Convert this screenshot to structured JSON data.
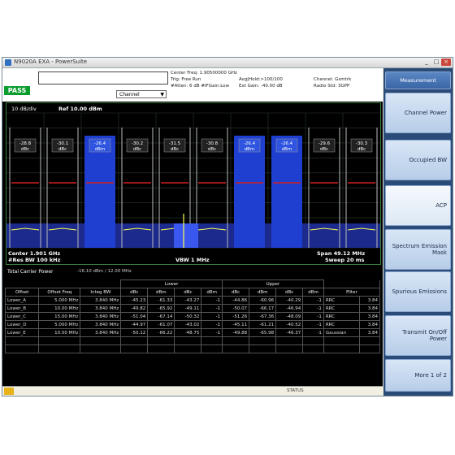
{
  "window": {
    "title": "N9020A EXA - PowerSuite",
    "minimize": "_",
    "maximize": "□",
    "close": "×"
  },
  "status": {
    "pass_label": "PASS",
    "mode_dropdown": "Channel",
    "settings": {
      "line1": "Center Freq: 1.90500000 GHz",
      "line2a": "Trig: Free Run",
      "line2b": "Avg|Hold:>100/100",
      "line2c": "Channel: Gsmtrk",
      "line3a": "#Atten: 6 dB #IFGain:Low",
      "line3b": "Ext Gain: -40.00 dB",
      "line3c": "Radio Std: 3GPP"
    }
  },
  "spectrum": {
    "y_label": "10 dB/div",
    "ref_label": "Ref 10.00 dBm",
    "center": "Center 1.901 GHz",
    "res_bw": "#Res BW 100 kHz",
    "vbw": "VBW 1 MHz",
    "span": "Span 49.12 MHz",
    "sweep": "Sweep 20 ms",
    "carrier_boxes": [
      {
        "line1": "-28.8",
        "line2": "dBc",
        "active": false
      },
      {
        "line1": "-30.1",
        "line2": "dBc",
        "active": false
      },
      {
        "line1": "-26.4",
        "line2": "dBm",
        "active": true
      },
      {
        "line1": "-30.2",
        "line2": "dBc",
        "active": false
      },
      {
        "line1": "-31.5",
        "line2": "dBc",
        "active": false
      },
      {
        "line1": "-30.8",
        "line2": "dBc",
        "active": false
      },
      {
        "line1": "-26.4",
        "line2": "dBm",
        "active": true
      },
      {
        "line1": "-26.4",
        "line2": "dBm",
        "active": true
      },
      {
        "line1": "-29.6",
        "line2": "dBc",
        "active": false
      },
      {
        "line1": "-30.3",
        "line2": "dBc",
        "active": false
      }
    ]
  },
  "table": {
    "title": "Total Carrier Power",
    "value": "-16.10 dBm / 12.00 MHz",
    "group_lower": "Lower",
    "group_upper": "Upper",
    "sub_headers": [
      "dBc",
      "dBm",
      "dBc",
      "dBm",
      "dBc",
      "dBm",
      "dBc",
      "dBm"
    ],
    "filter": "Filter",
    "columns": [
      "Offset",
      "Offset Freq",
      "Integ BW"
    ],
    "rows": [
      [
        "Lower_A",
        "5.000 MHz",
        "3.840 MHz",
        "-45.23",
        "-61.33",
        "-43.27",
        "-1",
        "-44.86",
        "-60.96",
        "-40.29",
        "-1",
        "RRC",
        "3.84"
      ],
      [
        "Lower_B",
        "10.00 MHz",
        "3.840 MHz",
        "-49.82",
        "-65.92",
        "-49.11",
        "-1",
        "-50.07",
        "-66.17",
        "-46.94",
        "-1",
        "RRC",
        "3.84"
      ],
      [
        "Lower_C",
        "15.00 MHz",
        "3.840 MHz",
        "-51.04",
        "-67.14",
        "-50.32",
        "-1",
        "-51.26",
        "-67.36",
        "-48.09",
        "-1",
        "RRC",
        "3.84"
      ],
      [
        "Lower_D",
        "5.000 MHz",
        "3.840 MHz",
        "-44.97",
        "-61.07",
        "-43.02",
        "-1",
        "-45.11",
        "-61.21",
        "-40.52",
        "-1",
        "RRC",
        "3.84"
      ],
      [
        "Lower_E",
        "10.00 MHz",
        "3.840 MHz",
        "-50.12",
        "-66.22",
        "-48.75",
        "-1",
        "-49.88",
        "-65.98",
        "-46.37",
        "-1",
        "Gaussian",
        "3.84"
      ]
    ],
    "empty_rows": 2
  },
  "statusbar": {
    "message": "STATUS"
  },
  "softkeys": {
    "header": "Measurement",
    "items": [
      {
        "label": "Channel Power",
        "active": false
      },
      {
        "label": "Occupied BW",
        "active": false
      },
      {
        "label": "ACP",
        "active": true
      },
      {
        "label": "Spectrum Emission Mask",
        "active": false
      },
      {
        "label": "Spurious Emissions",
        "active": false
      },
      {
        "label": "Transmit On/Off Power",
        "active": false
      },
      {
        "label": "More 1 of 2",
        "active": false
      }
    ]
  },
  "colors": {
    "pass_green": "#0a9d2e",
    "active_channel": "#1f3fd0",
    "limit_line": "#d01f1f",
    "trace": "#ffff55",
    "softkey_panel": "#2a4b78"
  }
}
